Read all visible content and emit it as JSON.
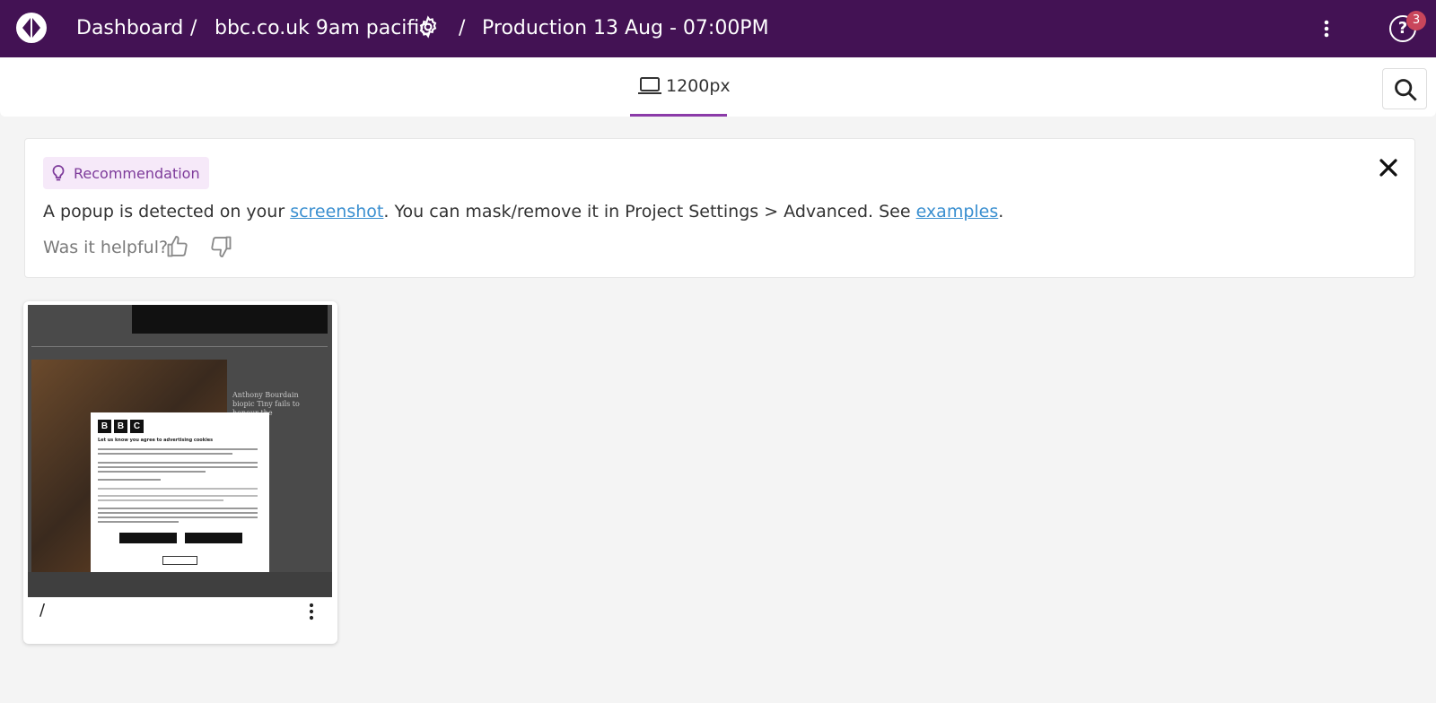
{
  "header": {
    "breadcrumb": [
      "Dashboard",
      "bbc.co.uk 9am pacific",
      "Production 13 Aug - 07:00PM"
    ],
    "separator": "/",
    "help_badge_count": "3",
    "help_icon": "?"
  },
  "viewport": {
    "tab_label": "1200px"
  },
  "recommendation": {
    "tag": "Recommendation",
    "message_prefix": "A popup is detected on your ",
    "link_screenshot": "screenshot",
    "message_middle": ". You can mask/remove it in Project Settings > Advanced. See ",
    "link_examples": "examples",
    "message_suffix": ".",
    "helpful_prompt": "Was it helpful?"
  },
  "screenshot_card": {
    "path": "/",
    "preview": {
      "modal_title": "Let us know you agree to advertising cookies",
      "headline": "Anthony Bourdain biopic Tiny fails to honour the"
    }
  },
  "colors": {
    "topbar": "#431254",
    "accent": "#8b3aa8",
    "badge": "#c9465b",
    "link": "#3a8fd0"
  }
}
